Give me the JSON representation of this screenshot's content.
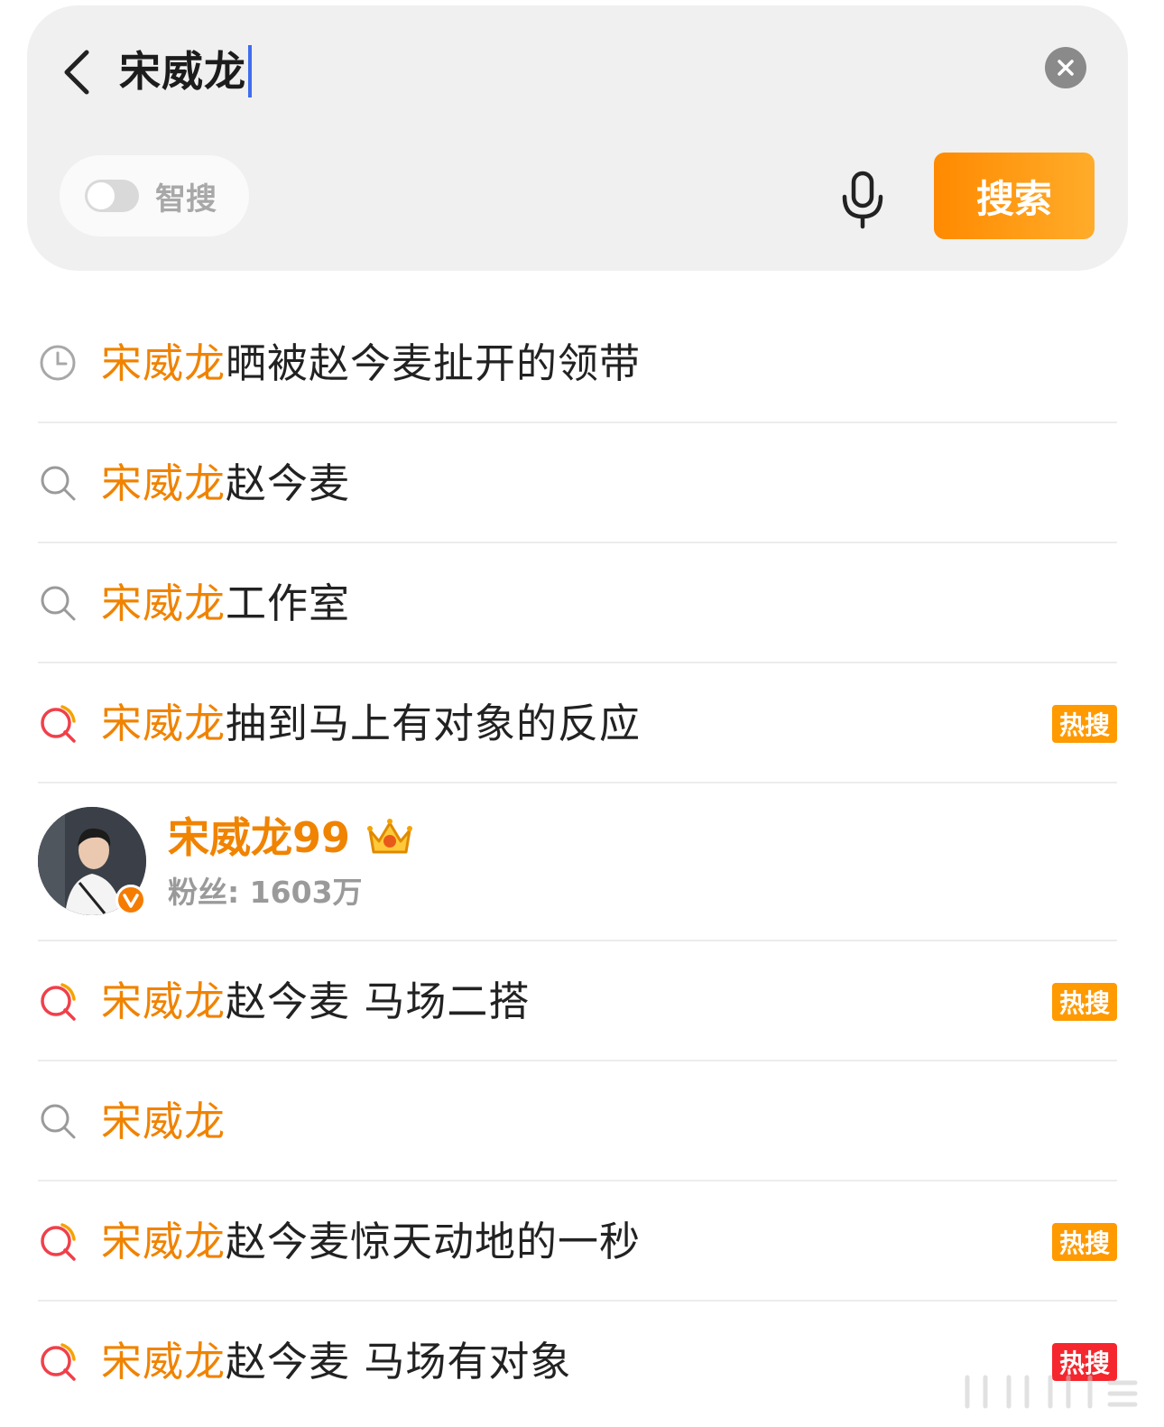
{
  "search": {
    "query": "宋威龙",
    "smart_label": "智搜",
    "button_label": "搜索"
  },
  "suggestions": [
    {
      "highlight": "宋威龙",
      "rest": "晒被赵今麦扯开的领带",
      "icon": "clock-icon",
      "badge": ""
    },
    {
      "highlight": "宋威龙",
      "rest": "赵今麦",
      "icon": "search-icon",
      "badge": ""
    },
    {
      "highlight": "宋威龙",
      "rest": "工作室",
      "icon": "search-icon",
      "badge": ""
    },
    {
      "highlight": "宋威龙",
      "rest": "抽到马上有对象的反应",
      "icon": "hot-search-icon",
      "badge": "热搜"
    },
    {
      "highlight": "宋威龙",
      "rest": "赵今麦 马场二搭",
      "icon": "hot-search-icon",
      "badge": "热搜"
    },
    {
      "highlight": "宋威龙",
      "rest": "",
      "icon": "search-icon",
      "badge": ""
    },
    {
      "highlight": "宋威龙",
      "rest": "赵今麦惊天动地的一秒",
      "icon": "hot-search-icon",
      "badge": "热搜"
    },
    {
      "highlight": "宋威龙",
      "rest": "赵今麦 马场有对象",
      "icon": "hot-search-icon",
      "badge": "热搜"
    }
  ],
  "user": {
    "name": "宋威龙99",
    "fans": "粉丝: 1603万",
    "verified_icon": "verified-v-icon",
    "crown_icon": "crown-icon"
  },
  "colors": {
    "highlight": "#f08300",
    "search_button": "#ff8a00",
    "hot_badge": "#ff9a00",
    "hot_badge_red": "#f5262d",
    "caret": "#3f6df0"
  }
}
